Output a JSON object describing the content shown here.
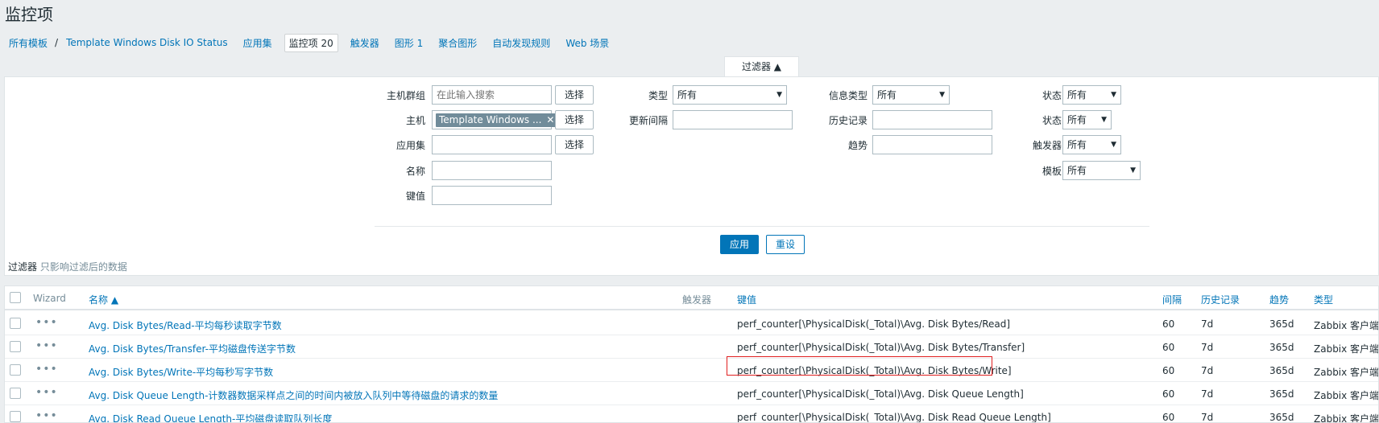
{
  "page": {
    "title": "监控项"
  },
  "breadcrumb": {
    "all_templates": "所有模板",
    "separator": "/",
    "template": "Template Windows Disk IO Status",
    "applications": "应用集",
    "items_label": "监控项",
    "items_count": "20",
    "triggers": "触发器",
    "graphs_label": "图形",
    "graphs_count": "1",
    "screens": "聚合图形",
    "discovery": "自动发现规则",
    "web": "Web 场景"
  },
  "filter": {
    "tab_label": "过滤器 ▲",
    "hostgroup_label": "主机群组",
    "hostgroup_placeholder": "在此输入搜索",
    "select_label": "选择",
    "host_label": "主机",
    "host_chip": "Template Windows ...",
    "chip_remove": "✕",
    "application_label": "应用集",
    "name_label": "名称",
    "key_label": "键值",
    "type_label": "类型",
    "type_value": "所有",
    "interval_label": "更新间隔",
    "info_type_label": "信息类型",
    "info_type_value": "所有",
    "history_label": "历史记录",
    "trends_label": "趋势",
    "state_label": "状态",
    "state_value": "所有",
    "status_label": "状态",
    "status_value": "所有",
    "triggers_label": "触发器",
    "triggers_value": "所有",
    "template_label": "模板",
    "template_value": "所有",
    "dropdown_arrow": "▼",
    "apply_label": "应用",
    "reset_label": "重设",
    "note_title": "过滤器",
    "note_sub": "只影响过滤后的数据"
  },
  "table": {
    "headers": {
      "wizard": "Wizard",
      "name": "名称 ▲",
      "triggers": "触发器",
      "key": "键值",
      "interval": "间隔",
      "history": "历史记录",
      "trends": "趋势",
      "type": "类型"
    },
    "dots": "•••",
    "rows": [
      {
        "name": "Avg. Disk Bytes/Read-平均每秒读取字节数",
        "key": "perf_counter[\\PhysicalDisk(_Total)\\Avg. Disk Bytes/Read]",
        "interval": "60",
        "history": "7d",
        "trends": "365d",
        "type": "Zabbix 客户端"
      },
      {
        "name": "Avg. Disk Bytes/Transfer-平均磁盘传送字节数",
        "key": "perf_counter[\\PhysicalDisk(_Total)\\Avg. Disk Bytes/Transfer]",
        "interval": "60",
        "history": "7d",
        "trends": "365d",
        "type": "Zabbix 客户端"
      },
      {
        "name": "Avg. Disk Bytes/Write-平均每秒写字节数",
        "key": "perf_counter[\\PhysicalDisk(_Total)\\Avg. Disk Bytes/Write]",
        "interval": "60",
        "history": "7d",
        "trends": "365d",
        "type": "Zabbix 客户端"
      },
      {
        "name": "Avg. Disk Queue Length-计数器数据采样点之间的时间内被放入队列中等待磁盘的请求的数量",
        "key": "perf_counter[\\PhysicalDisk(_Total)\\Avg. Disk Queue Length]",
        "interval": "60",
        "history": "7d",
        "trends": "365d",
        "type": "Zabbix 客户端"
      },
      {
        "name": "Avg. Disk Read Queue Length-平均磁盘读取队列长度",
        "key": "perf_counter[\\PhysicalDisk(_Total)\\Avg. Disk Read Queue Length]",
        "interval": "60",
        "history": "7d",
        "trends": "365d",
        "type": "Zabbix 客户端"
      }
    ]
  }
}
